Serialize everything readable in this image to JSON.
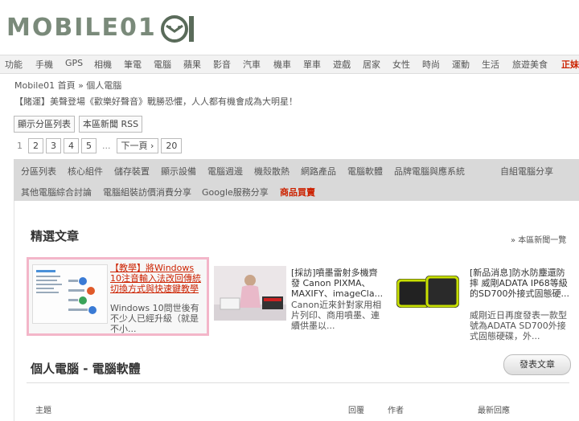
{
  "header": {
    "logo_text": "MOBILE01"
  },
  "nav": [
    {
      "label": "功能"
    },
    {
      "label": "手機"
    },
    {
      "label": "GPS"
    },
    {
      "label": "相機"
    },
    {
      "label": "筆電"
    },
    {
      "label": "電腦"
    },
    {
      "label": "蘋果"
    },
    {
      "label": "影音"
    },
    {
      "label": "汽車"
    },
    {
      "label": "機車"
    },
    {
      "label": "單車"
    },
    {
      "label": "遊戲"
    },
    {
      "label": "居家"
    },
    {
      "label": "女性"
    },
    {
      "label": "時尚"
    },
    {
      "label": "運動"
    },
    {
      "label": "生活"
    },
    {
      "label": "旅遊美食"
    },
    {
      "label": "正妹"
    }
  ],
  "breadcrumb": "Mobile01 首頁 » 個人電腦",
  "promo": "【賭運】美聲登場《歡樂好聲音》戰勝恐懼，人人都有機會成為大明星！",
  "buttons": {
    "show_forum_list": "顯示分區列表",
    "rss": "本區新聞 RSS"
  },
  "pagination": {
    "current": "1",
    "pages": [
      "2",
      "3",
      "4",
      "5"
    ],
    "ellipsis": "...",
    "next": "下一頁 ›",
    "last": "20"
  },
  "categories": {
    "row1": [
      "分區列表",
      "核心組件",
      "儲存裝置",
      "顯示設備",
      "電腦週邊",
      "機殼散熱",
      "網路產品",
      "電腦軟體",
      "品牌電腦與應系統",
      "自組電腦分享"
    ],
    "row2": [
      "其他電腦綜合討論",
      "電腦組裝訪價消費分享",
      "Google服務分享",
      "商品買賣"
    ]
  },
  "featured": {
    "title": "精選文章",
    "more": "» 本區新聞一覽",
    "items": [
      {
        "title": "【教學】將Windows 10注音輸入法改回傳統切換方式與快速鍵教學",
        "desc": "Windows 10問世後有不少人已經升級（就是不小..."
      },
      {
        "title": "[採訪]噴墨雷射多機齊發 Canon PIXMA、MAXIFY、imageCla...",
        "desc": "Canon近來針對家用相片列印、商用噴墨、連續供墨以..."
      },
      {
        "title": "[新品消息]防水防塵還防摔 威剛ADATA IP68等級的SD700外接式固態硬...",
        "desc": "威剛近日再度發表一款型號為ADATA SD700外接式固態硬碟，外..."
      }
    ]
  },
  "section": {
    "title": "個人電腦 - 電腦軟體",
    "post_button": "發表文章"
  },
  "table_headers": {
    "topic": "主題",
    "replies": "回覆",
    "author": "作者",
    "latest": "最新回應"
  },
  "colors": {
    "accent_red": "#cc2200",
    "highlight_border": "#f3b6c9",
    "category_bg": "#d9d9d9"
  }
}
